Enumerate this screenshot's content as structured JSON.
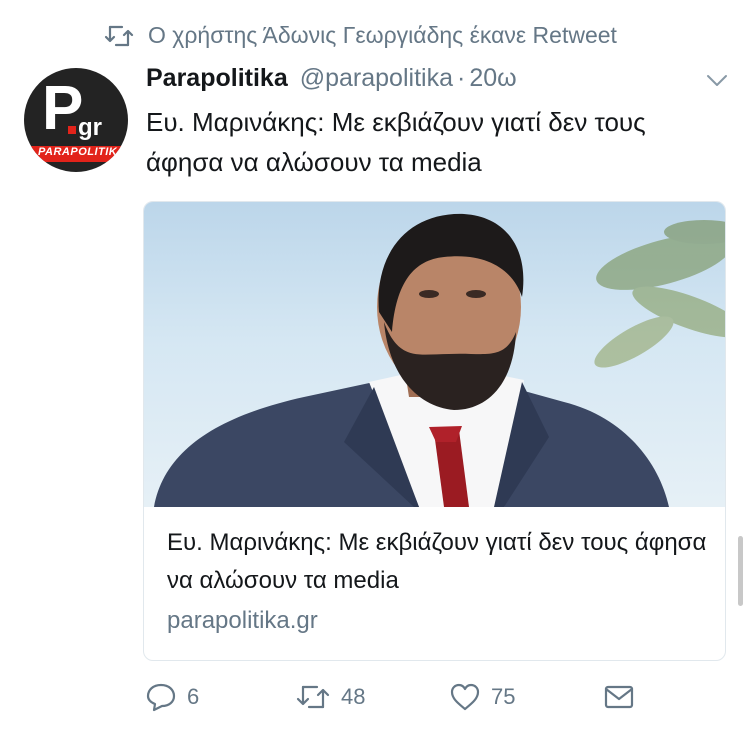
{
  "retweet_notice": {
    "text": "Ο χρήστης Άδωνις Γεωργιάδης έκανε Retweet",
    "icon": "retweet-icon"
  },
  "tweet": {
    "avatar": {
      "logo_mark": "P",
      "logo_suffix": "gr",
      "logo_word": "PARAPOLITIKA"
    },
    "author_name": "Parapolitika",
    "author_handle": "@parapolitika",
    "separator": "·",
    "timestamp": "20ω",
    "text": "Ευ. Μαρινάκης: Με εκβιάζουν γιατί δεν τους άφησα να αλώσουν τα media",
    "menu_icon": "chevron-down-icon"
  },
  "card": {
    "title": "Ευ. Μαρινάκης: Με εκβιάζουν γιατί δεν τους άφησα να αλώσουν τα media",
    "domain": "parapolitika.gr"
  },
  "actions": {
    "reply_count": "6",
    "retweet_count": "48",
    "like_count": "75"
  },
  "colors": {
    "text_primary": "#14171a",
    "text_secondary": "#657786",
    "card_border": "#e1e8ed",
    "brand_red": "#e2231a"
  }
}
